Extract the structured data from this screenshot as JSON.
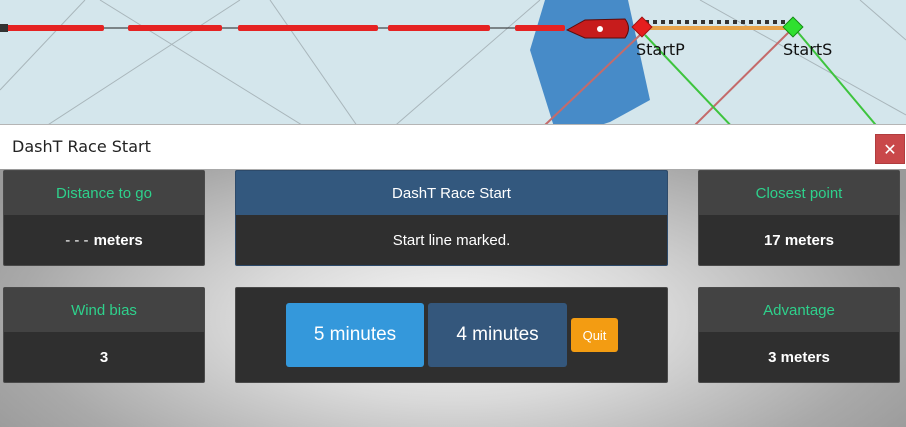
{
  "map": {
    "mark_port_label": "StartP",
    "mark_starboard_label": "StartS"
  },
  "dialog": {
    "title": "DashT Race Start",
    "close_glyph": "✕",
    "panels": {
      "distance": {
        "label": "Distance to go",
        "value_prefix": "- - -",
        "value_unit": "meters"
      },
      "status": {
        "label": "DashT Race Start",
        "value": "Start line marked."
      },
      "closest": {
        "label": "Closest point",
        "value": "17 meters"
      },
      "wind_bias": {
        "label": "Wind bias",
        "value": "3"
      },
      "advantage": {
        "label": "Advantage",
        "value": "3 meters"
      }
    },
    "buttons": {
      "five_min": "5 minutes",
      "four_min": "4 minutes",
      "quit": "Quit"
    }
  },
  "colors": {
    "label_green": "#2ed18c",
    "five_min_button": "#3498db",
    "four_min_button": "#34577c",
    "quit_button": "#f39c12",
    "close_button": "#c9484a"
  }
}
